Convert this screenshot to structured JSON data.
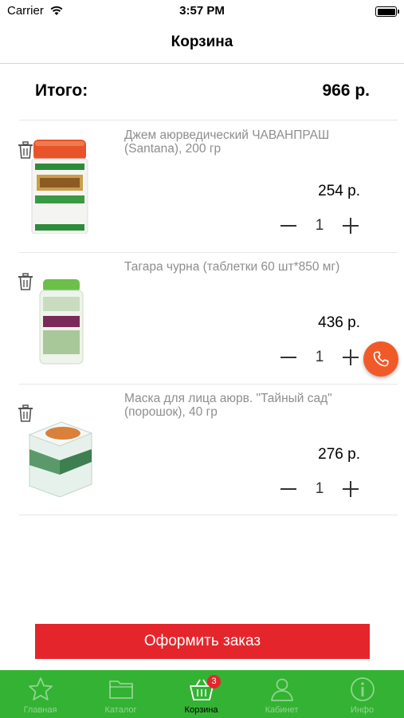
{
  "status_bar": {
    "carrier": "Carrier",
    "time": "3:57 PM"
  },
  "nav": {
    "title": "Корзина"
  },
  "summary": {
    "total_label": "Итого:",
    "total_value": "966 р."
  },
  "cart": {
    "items": [
      {
        "name": "Джем аюрведический ЧАВАНПРАШ (Santana), 200 гр",
        "price": "254 р.",
        "quantity": "1",
        "image": "chyawanprash-jar"
      },
      {
        "name": "Тагара чурна (таблетки 60 шт*850 мг)",
        "price": "436 р.",
        "quantity": "1",
        "image": "tagara-bottle"
      },
      {
        "name": "Маска для лица аюрв. \"Тайный сад\" (порошок), 40 гр",
        "price": "276 р.",
        "quantity": "1",
        "image": "face-mask-box"
      }
    ]
  },
  "actions": {
    "checkout_label": "Оформить заказ",
    "call_icon": "phone-icon"
  },
  "tab_bar": {
    "tabs": [
      {
        "label": "Главная",
        "icon": "star-icon"
      },
      {
        "label": "Каталог",
        "icon": "folder-icon"
      },
      {
        "label": "Корзина",
        "icon": "basket-icon",
        "badge": "3",
        "active": true
      },
      {
        "label": "Кабинет",
        "icon": "user-icon"
      },
      {
        "label": "Инфо",
        "icon": "info-icon"
      }
    ]
  },
  "colors": {
    "accent_red": "#e4262c",
    "tab_green": "#34b233",
    "call_orange": "#f05a28",
    "muted_text": "#8e8e8e"
  }
}
